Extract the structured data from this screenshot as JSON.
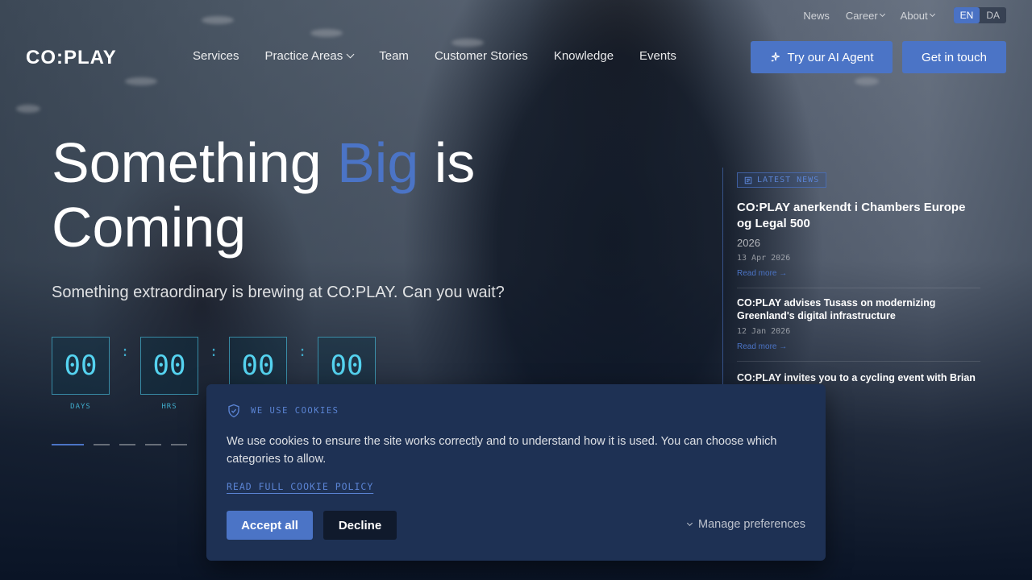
{
  "topbar": {
    "news": "News",
    "career": "Career",
    "about": "About",
    "lang_en": "EN",
    "lang_da": "DA"
  },
  "logo": "CO:PLAY",
  "nav": {
    "services": "Services",
    "practice_areas": "Practice Areas",
    "team": "Team",
    "customer_stories": "Customer Stories",
    "knowledge": "Knowledge",
    "events": "Events"
  },
  "header": {
    "ai_button": "Try our AI Agent",
    "contact_button": "Get in touch"
  },
  "hero": {
    "title_part1": "Something ",
    "title_accent": "Big",
    "title_part2": " is Coming",
    "subtitle": "Something extraordinary is brewing at CO:PLAY. Can you wait?",
    "countdown": {
      "days": "00",
      "days_label": "DAYS",
      "hrs": "00",
      "hrs_label": "HRS",
      "min": "00",
      "sec": "00",
      "sep": ":"
    },
    "slides_total": 6,
    "slides_active": 1
  },
  "news": {
    "badge": "LATEST NEWS",
    "items": [
      {
        "title": "CO:PLAY anerkendt i Chambers Europe og Legal 500",
        "year": "2026",
        "date": "13 Apr 2026",
        "more": "Read more →"
      },
      {
        "title": "CO:PLAY advises Tusass on modernizing Greenland's digital infrastructure",
        "date": "12 Jan 2026",
        "more": "Read more →"
      },
      {
        "title": "CO:PLAY invites you to a cycling event with Brian"
      }
    ]
  },
  "cookie": {
    "heading": "WE USE COOKIES",
    "text": "We use cookies to ensure the site works correctly and to understand how it is used. You can choose which categories to allow.",
    "policy_link": "READ FULL COOKIE POLICY",
    "accept": "Accept all",
    "decline": "Decline",
    "manage": "Manage preferences"
  },
  "colors": {
    "accent": "#4b74c6",
    "countdown": "#55d3f0",
    "banner": "#1e3154"
  }
}
